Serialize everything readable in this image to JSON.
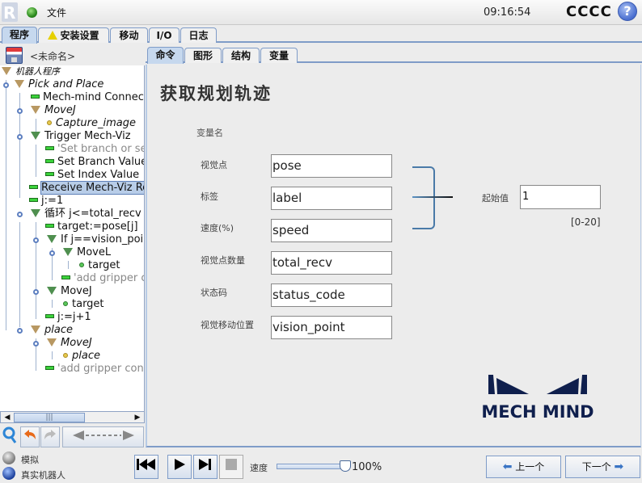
{
  "topbar": {
    "logo_text": "R",
    "file_menu": "文件",
    "clock": "09:16:54",
    "robot_name": "CCCC",
    "help": "?"
  },
  "main_tabs": [
    {
      "label": "程序",
      "active": true
    },
    {
      "label": "安装设置",
      "icon": "warning-icon"
    },
    {
      "label": "移动"
    },
    {
      "label": "I/O"
    },
    {
      "label": "日志"
    }
  ],
  "program": {
    "name": "<未命名>"
  },
  "tree": [
    {
      "label": "机器人程序",
      "icon": "brown-triangle",
      "italic": true
    },
    {
      "label": "Pick and Place",
      "icon": "brown-triangle",
      "italic": true
    },
    {
      "label": "Mech-mind Connect",
      "icon": "green-bar"
    },
    {
      "label": "MoveJ",
      "icon": "brown-triangle",
      "italic": true
    },
    {
      "label": "Capture_image",
      "icon": "yellow-dot",
      "italic": true
    },
    {
      "label": "Trigger Mech-Viz",
      "icon": "green-triangle"
    },
    {
      "label": "'Set branch or se",
      "icon": "green-bar",
      "grey": true
    },
    {
      "label": "Set Branch Value",
      "icon": "green-bar"
    },
    {
      "label": "Set Index Value",
      "icon": "green-bar"
    },
    {
      "label": "Receive Mech-Viz Re",
      "icon": "green-bar",
      "selected": true
    },
    {
      "label": "j:=1",
      "icon": "green-bar"
    },
    {
      "label": "循环 j<=total_recv",
      "icon": "green-triangle"
    },
    {
      "label": "target:=pose[j]",
      "icon": "green-bar"
    },
    {
      "label": "If j==vision_poin",
      "icon": "green-triangle"
    },
    {
      "label": "MoveL",
      "icon": "green-triangle"
    },
    {
      "label": "target",
      "icon": "green-dot"
    },
    {
      "label": "'add gripper c",
      "icon": "green-bar",
      "grey": true
    },
    {
      "label": "MoveJ",
      "icon": "green-triangle"
    },
    {
      "label": "target",
      "icon": "green-dot"
    },
    {
      "label": "j:=j+1",
      "icon": "green-bar"
    },
    {
      "label": "place",
      "icon": "brown-triangle",
      "italic": true
    },
    {
      "label": "MoveJ",
      "icon": "brown-triangle",
      "italic": true
    },
    {
      "label": "place",
      "icon": "yellow-dot",
      "italic": true
    },
    {
      "label": "'add gripper cont",
      "icon": "green-bar",
      "grey": true
    }
  ],
  "scroll": {
    "thumb_grip": "|||",
    "left": "◀",
    "right": "▶"
  },
  "sub_tabs": [
    {
      "label": "命令",
      "active": true
    },
    {
      "label": "图形"
    },
    {
      "label": "结构"
    },
    {
      "label": "变量"
    }
  ],
  "form": {
    "title": "获取规划轨迹",
    "var_header": "变量名",
    "fields": [
      {
        "label": "视觉点",
        "value": "pose"
      },
      {
        "label": "标签",
        "value": "label"
      },
      {
        "label": "速度(%)",
        "value": "speed"
      },
      {
        "label": "视觉点数量",
        "value": "total_recv"
      },
      {
        "label": "状态码",
        "value": "status_code"
      },
      {
        "label": "视觉移动位置",
        "value": "vision_point"
      }
    ],
    "start_label": "起始值",
    "start_value": "1",
    "range": "[0-20]"
  },
  "logo": {
    "text": "MECH MIND",
    "color": "#0f1f4d"
  },
  "bottom": {
    "mode_sim": "模拟",
    "mode_real": "真实机器人",
    "speed_label": "速度",
    "speed_value": "100%",
    "speed_fraction": 1.0,
    "prev": "上一个",
    "next": "下一个"
  }
}
